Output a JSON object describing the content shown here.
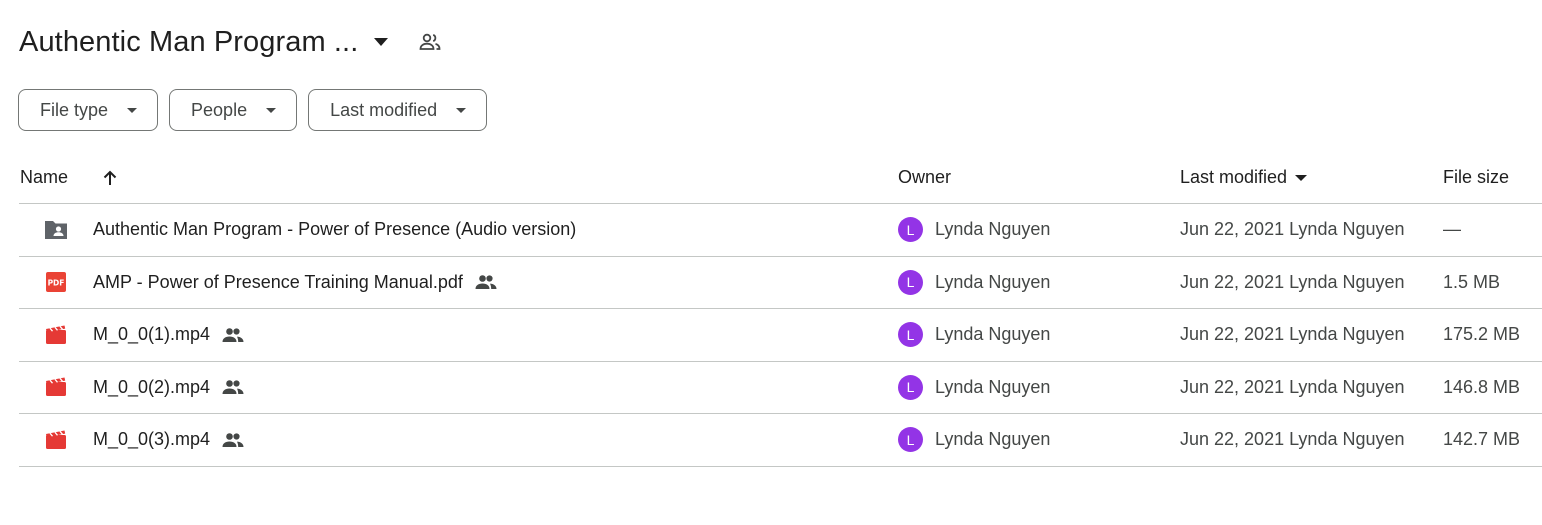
{
  "header": {
    "title": "Authentic Man Program ...",
    "dropdown_icon": "arrow-drop-down-icon",
    "shared_icon": "shared-people-icon"
  },
  "filters": [
    {
      "label": "File type"
    },
    {
      "label": "People"
    },
    {
      "label": "Last modified"
    }
  ],
  "table": {
    "columns": {
      "name": "Name",
      "owner": "Owner",
      "last_modified": "Last modified",
      "file_size": "File size"
    },
    "rows": [
      {
        "icon": "shared-folder-icon",
        "name": "Authentic Man Program - Power of Presence (Audio version)",
        "shared": false,
        "owner_initial": "L",
        "owner": "Lynda Nguyen",
        "modified": "Jun 22, 2021 Lynda Nguyen",
        "size": "—"
      },
      {
        "icon": "pdf-icon",
        "name": "AMP - Power of Presence Training Manual.pdf",
        "shared": true,
        "owner_initial": "L",
        "owner": "Lynda Nguyen",
        "modified": "Jun 22, 2021 Lynda Nguyen",
        "size": "1.5 MB"
      },
      {
        "icon": "video-icon",
        "name": "M_0_0(1).mp4",
        "shared": true,
        "owner_initial": "L",
        "owner": "Lynda Nguyen",
        "modified": "Jun 22, 2021 Lynda Nguyen",
        "size": "175.2 MB"
      },
      {
        "icon": "video-icon",
        "name": "M_0_0(2).mp4",
        "shared": true,
        "owner_initial": "L",
        "owner": "Lynda Nguyen",
        "modified": "Jun 22, 2021 Lynda Nguyen",
        "size": "146.8 MB"
      },
      {
        "icon": "video-icon",
        "name": "M_0_0(3).mp4",
        "shared": true,
        "owner_initial": "L",
        "owner": "Lynda Nguyen",
        "modified": "Jun 22, 2021 Lynda Nguyen",
        "size": "142.7 MB"
      }
    ]
  },
  "colors": {
    "avatar": "#9334e6",
    "pdf_red": "#ea4335",
    "video_red": "#e53935",
    "folder_gray": "#5f6368",
    "border": "#c4c7c5"
  }
}
